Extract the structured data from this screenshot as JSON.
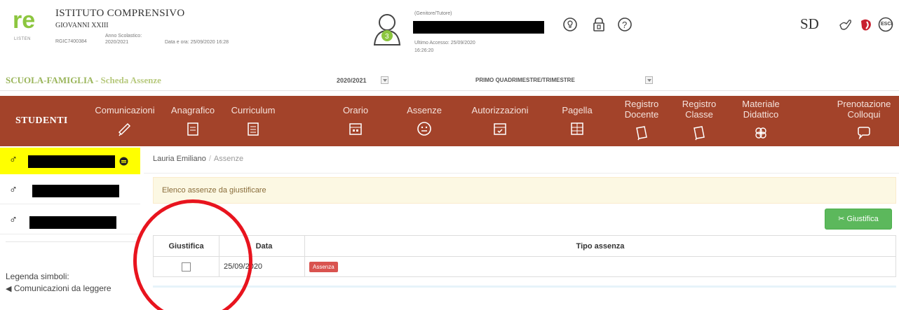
{
  "header": {
    "school_title": "ISTITUTO COMPRENSIVO",
    "school_subtitle": "GIOVANNI XXIII",
    "logo_sub": "LISTEN",
    "school_code": "RGIC7400384",
    "anno_label": "Anno Scolastico:",
    "anno_value": "2020/2021",
    "date_time": "Data e ora: 25/09/2020 16:28",
    "user_role": "(Genitore/Tutore)",
    "last_access_label": "Ultimo Accesso: 25/09/2020",
    "last_access_time": "16:26:20",
    "right_logo_text": "SD",
    "esci_label": "ESCI"
  },
  "subbar": {
    "section_title": "SCUOLA-FAMIGLIA",
    "section_page": " - Scheda Assenze",
    "year": "2020/2021",
    "period": "PRIMO QUADRIMESTRE/TRIMESTRE"
  },
  "nav": {
    "studenti": "STUDENTI",
    "items": [
      {
        "label": "Comunicazioni",
        "icon": "megaphone-icon"
      },
      {
        "label": "Anagrafico",
        "icon": "id-card-icon"
      },
      {
        "label": "Curriculum",
        "icon": "document-icon"
      },
      {
        "label": "Orario",
        "icon": "calendar-icon"
      },
      {
        "label": "Assenze",
        "icon": "smiley-icon"
      },
      {
        "label": "Autorizzazioni",
        "icon": "calendar-check-icon"
      },
      {
        "label": "Pagella",
        "icon": "report-card-icon"
      },
      {
        "label_line1": "Registro",
        "label_line2": "Docente",
        "icon": "book-icon"
      },
      {
        "label_line1": "Registro",
        "label_line2": "Classe",
        "icon": "book-icon"
      },
      {
        "label_line1": "Materiale",
        "label_line2": "Didattico",
        "icon": "flower-icon"
      },
      {
        "label_line1": "Prenotazione",
        "label_line2": "Colloqui",
        "icon": "speech-icon"
      }
    ]
  },
  "sidebar": {
    "legend_title": "Legenda simboli:",
    "legend_item": "Comunicazioni da leggere"
  },
  "breadcrumb": {
    "student": "Lauria Emiliano",
    "current": "Assenze"
  },
  "alert_text": "Elenco assenze da giustificare",
  "button_giustifica": "Giustifica",
  "table": {
    "headers": [
      "Giustifica",
      "Data",
      "Tipo assenza"
    ],
    "rows": [
      {
        "date": "25/09/2020",
        "type": "Assenza"
      }
    ]
  },
  "colors": {
    "nav_bg": "#a3432a",
    "accent_green": "#9ab55b",
    "button_green": "#5cb85c",
    "badge_red": "#d9534f",
    "highlight_yellow": "#ffff00",
    "annotation_circle": "#e8141e"
  }
}
